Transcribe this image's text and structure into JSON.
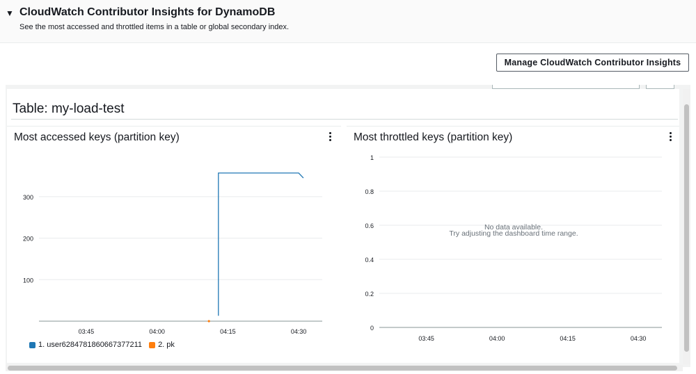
{
  "header": {
    "caret": "▼",
    "title": "CloudWatch Contributor Insights for DynamoDB",
    "description": "See the most accessed and throttled items in a table or global secondary index."
  },
  "toolbar": {
    "manage_label": "Manage CloudWatch Contributor Insights"
  },
  "table": {
    "title": "Table: my-load-test"
  },
  "widgets": [
    {
      "title": "Most accessed keys (partition key)",
      "legend": [
        {
          "label": "1. user6284781860667377211",
          "color": "#1f77b4"
        },
        {
          "label": "2. pk",
          "color": "#ff7f0e"
        }
      ]
    },
    {
      "title": "Most throttled keys (partition key)",
      "empty_line1": "No data available.",
      "empty_line2": "Try adjusting the dashboard time range."
    }
  ],
  "chart_data": [
    {
      "type": "line",
      "title": "Most accessed keys (partition key)",
      "x_ticks": [
        "03:45",
        "04:00",
        "04:15",
        "04:30"
      ],
      "y_ticks": [
        100,
        200,
        300
      ],
      "series": [
        {
          "name": "1. user6284781860667377211",
          "color": "#1f77b4",
          "points": [
            [
              "04:13",
              13
            ],
            [
              "04:13",
              357
            ],
            [
              "04:30",
              357
            ],
            [
              "04:31",
              345
            ]
          ]
        },
        {
          "name": "2. pk",
          "color": "#ff7f0e",
          "points": [
            [
              "04:11",
              0
            ]
          ]
        }
      ]
    },
    {
      "type": "line",
      "title": "Most throttled keys (partition key)",
      "x_ticks": [
        "03:45",
        "04:00",
        "04:15",
        "04:30"
      ],
      "y_ticks": [
        "0",
        "0.2",
        "0.4",
        "0.6",
        "0.8",
        "1"
      ],
      "ylim": [
        0,
        1
      ],
      "series": []
    }
  ]
}
